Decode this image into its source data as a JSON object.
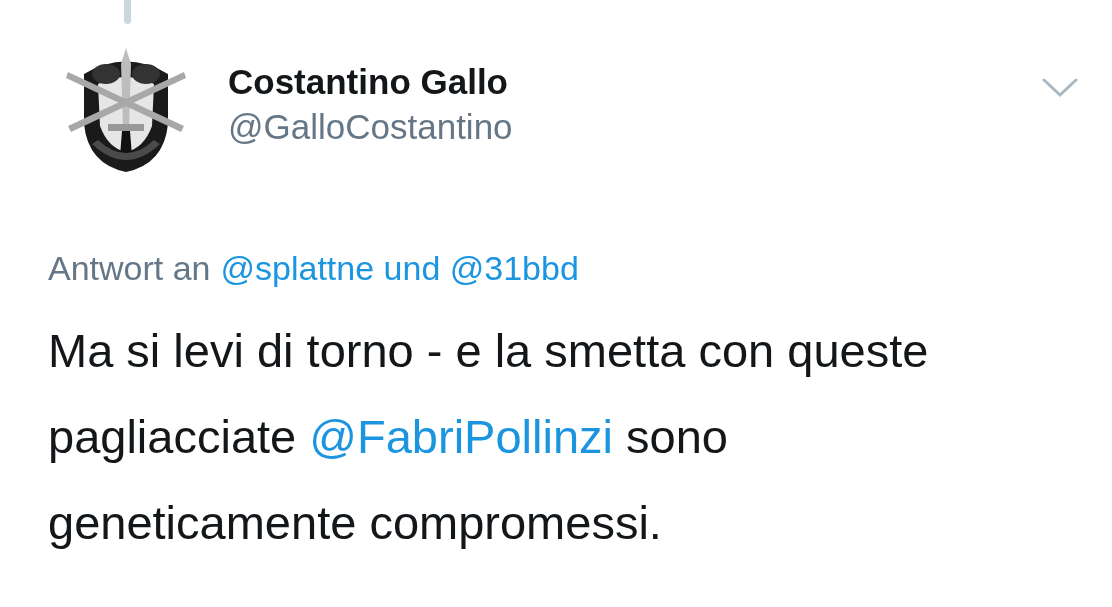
{
  "tweet": {
    "author": {
      "name": "Costantino Gallo",
      "handle": "@GalloCostantino"
    },
    "reply_to": {
      "label": "Antwort an",
      "mentions": "@splattne und @31bbd"
    },
    "body": [
      {
        "kind": "text",
        "text": "Ma si levi di torno - e la smetta con queste pagliacciate "
      },
      {
        "kind": "mention",
        "text": "@FabriPollinzi"
      },
      {
        "kind": "text",
        "text": " sono geneticamente compromessi."
      }
    ]
  }
}
